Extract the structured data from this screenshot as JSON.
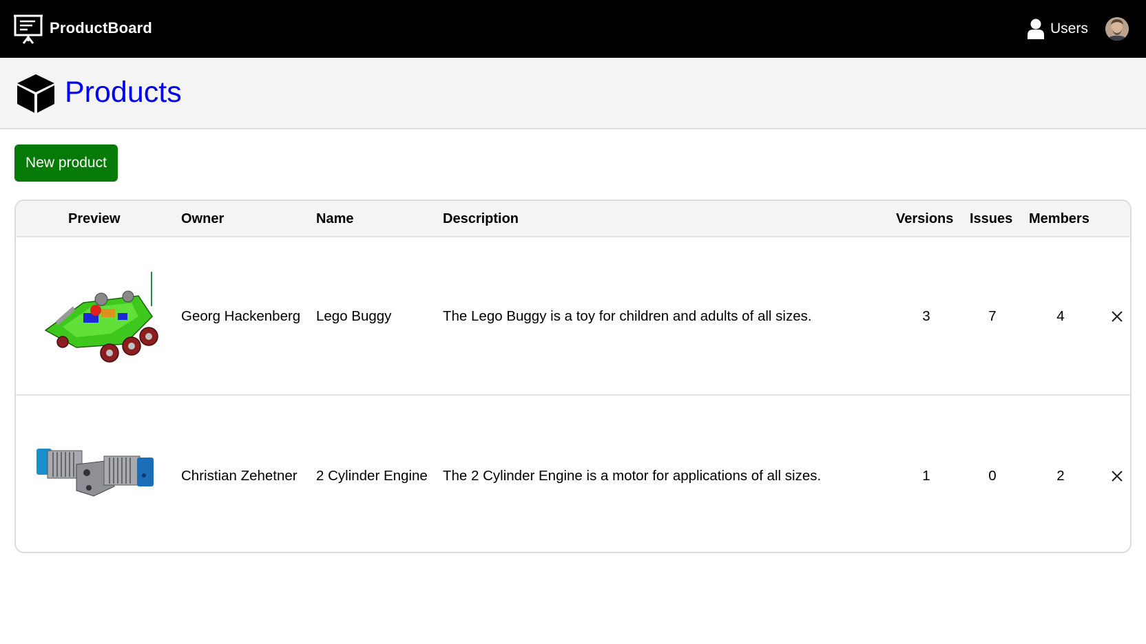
{
  "app": {
    "brand": "ProductBoard",
    "users_label": "Users"
  },
  "page": {
    "title": "Products",
    "new_button": "New product"
  },
  "table": {
    "headers": {
      "preview": "Preview",
      "owner": "Owner",
      "name": "Name",
      "description": "Description",
      "versions": "Versions",
      "issues": "Issues",
      "members": "Members"
    },
    "rows": [
      {
        "owner": "Georg Hackenberg",
        "name": "Lego Buggy",
        "description": "The Lego Buggy is a toy for children and adults of all sizes.",
        "versions": "3",
        "issues": "7",
        "members": "4"
      },
      {
        "owner": "Christian Zehetner",
        "name": "2 Cylinder Engine",
        "description": "The 2 Cylinder Engine is a motor for applications of all sizes.",
        "versions": "1",
        "issues": "0",
        "members": "2"
      }
    ]
  },
  "colors": {
    "topbar": "#000000",
    "title_link": "#0000ee",
    "primary_button": "#067a06"
  },
  "icons": [
    "presentation-board-icon",
    "user-icon",
    "cube-icon",
    "close-icon"
  ]
}
